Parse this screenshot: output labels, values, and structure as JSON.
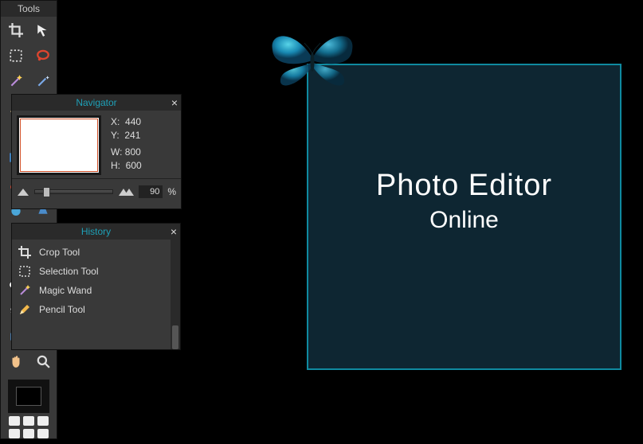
{
  "brand": {
    "title": "Photo Editor",
    "subtitle": "Online"
  },
  "navigator": {
    "title": "Navigator",
    "x_label": "X:",
    "x_val": "440",
    "y_label": "Y:",
    "y_val": "241",
    "w_label": "W:",
    "w_val": "800",
    "h_label": "H:",
    "h_val": "600",
    "zoom_val": "90",
    "pct": "%"
  },
  "history": {
    "title": "History",
    "items": [
      {
        "label": "Crop Tool",
        "icon": "crop"
      },
      {
        "label": "Selection Tool",
        "icon": "marquee"
      },
      {
        "label": "Magic Wand",
        "icon": "wand"
      },
      {
        "label": "Pencil Tool",
        "icon": "pencil"
      }
    ]
  },
  "tools": {
    "title": "Tools",
    "selected_index": 13,
    "items": [
      "crop",
      "move",
      "marquee",
      "lasso",
      "wand",
      "wand-plus",
      "pencil",
      "brush",
      "eraser",
      "paint-bucket",
      "gradient",
      "stamp",
      "heal-brush",
      "shape",
      "blur",
      "sharpen",
      "sponge",
      "warp",
      "dodge",
      "burn",
      "eye",
      "red-eye",
      "spot",
      "clone",
      "shape-tool",
      "text",
      "hand",
      "zoom"
    ]
  }
}
